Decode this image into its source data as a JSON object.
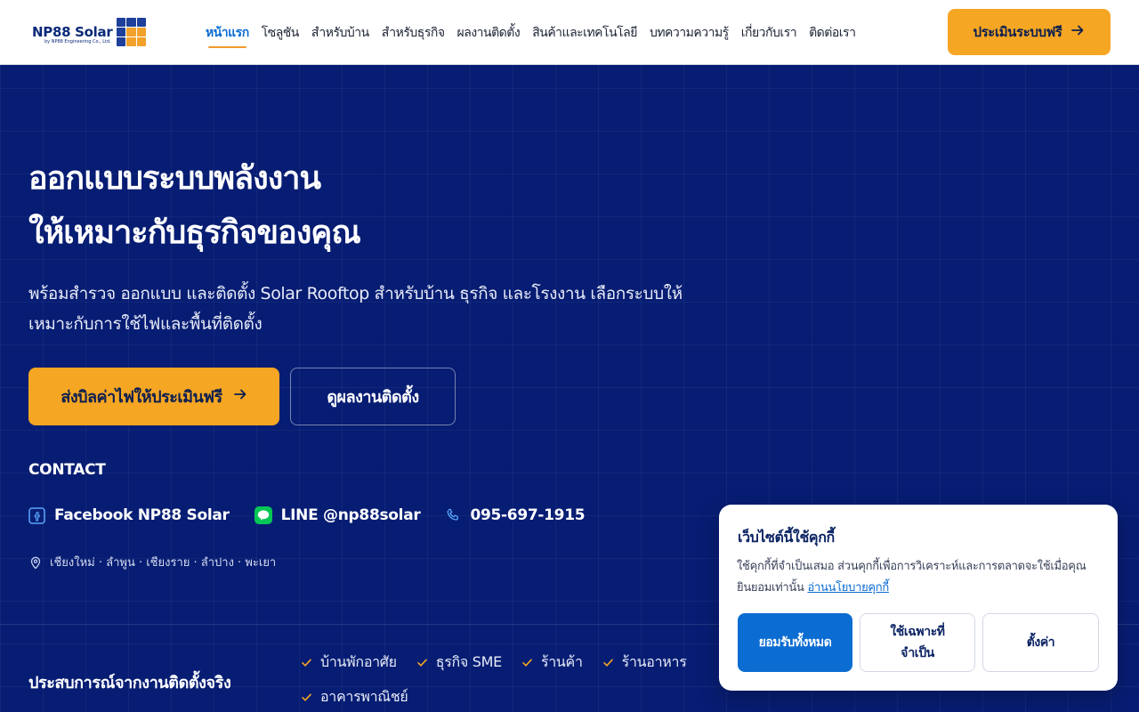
{
  "header": {
    "logo_text": "NP88 Solar",
    "logo_subtext": "by NP88 Engineering Co., Ltd.",
    "nav": [
      {
        "label": "หน้าแรก",
        "active": true
      },
      {
        "label": "โซลูชัน"
      },
      {
        "label": "สำหรับบ้าน"
      },
      {
        "label": "สำหรับธุรกิจ"
      },
      {
        "label": "ผลงานติดตั้ง"
      },
      {
        "label": "สินค้าและเทคโนโลยี"
      },
      {
        "label": "บทความความรู้"
      },
      {
        "label": "เกี่ยวกับเรา"
      },
      {
        "label": "ติดต่อเรา"
      }
    ],
    "cta_label": "ประเมินระบบฟรี"
  },
  "hero": {
    "title_line1": "ออกแบบระบบพลังงาน",
    "title_line2": "ให้เหมาะกับธุรกิจของคุณ",
    "description": "พร้อมสำรวจ ออกแบบ และติดตั้ง Solar Rooftop สำหรับบ้าน ธุรกิจ และโรงงาน เลือกระบบให้เหมาะกับการใช้ไฟและพื้นที่ติดตั้ง",
    "primary_button": "ส่งบิลค่าไฟให้ประเมินฟรี",
    "secondary_button": "ดูผลงานติดตั้ง"
  },
  "contact": {
    "label": "CONTACT",
    "facebook": "Facebook NP88 Solar",
    "line": "LINE @np88solar",
    "phone": "095-697-1915",
    "areas": "เชียงใหม่ · ลำพูน · เชียงราย · ลำปาง · พะเยา"
  },
  "experience": {
    "label": "ประสบการณ์จากงานติดตั้งจริง",
    "tags": [
      "บ้านพักอาศัย",
      "ธุรกิจ SME",
      "ร้านค้า",
      "ร้านอาหาร",
      "อาคารพาณิชย์"
    ]
  },
  "cookie": {
    "title": "เว็บไซต์นี้ใช้คุกกี้",
    "text": "ใช้คุกกี้ที่จำเป็นเสมอ ส่วนคุกกี้เพื่อการวิเคราะห์และการตลาดจะใช้เมื่อคุณยินยอมเท่านั้น",
    "link": "อ่านนโยบายคุกกี้",
    "accept": "ยอมรับทั้งหมด",
    "necessary": "ใช้เฉพาะที่จำเป็น",
    "settings": "ตั้งค่า"
  },
  "colors": {
    "background": "#071d73",
    "accent": "#f5a623",
    "link_blue": "#0b6cd1"
  },
  "icons": [
    "arrow-right-icon",
    "facebook-icon",
    "line-icon",
    "phone-icon",
    "map-pin-icon",
    "check-icon"
  ]
}
